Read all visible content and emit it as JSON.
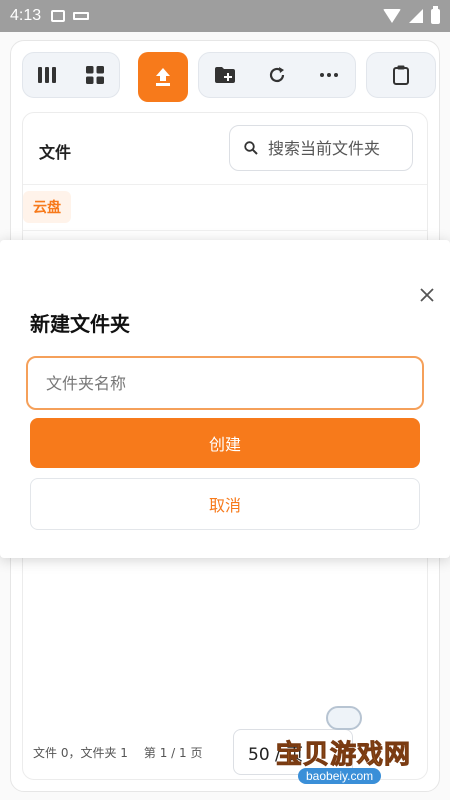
{
  "status_bar": {
    "time": "4:13"
  },
  "toolbar": {
    "icons": [
      "columns-view-icon",
      "grid-view-icon",
      "upload-icon",
      "new-folder-icon",
      "refresh-icon",
      "more-icon",
      "clipboard-icon"
    ]
  },
  "file_panel": {
    "title": "文件",
    "search_placeholder": "搜索当前文件夹",
    "breadcrumb_root": "云盘",
    "footer": {
      "counts": "文件 0，文件夹 1",
      "pages": "第 1 / 1 页",
      "page_size": "50 / 页"
    }
  },
  "dialog": {
    "title": "新建文件夹",
    "input_placeholder": "文件夹名称",
    "create_label": "创建",
    "cancel_label": "取消"
  },
  "watermark": {
    "text": "宝贝游戏网",
    "url": "baobeiy.com"
  },
  "colors": {
    "accent": "#f77a1b",
    "status_bar": "#9e9e9e"
  }
}
